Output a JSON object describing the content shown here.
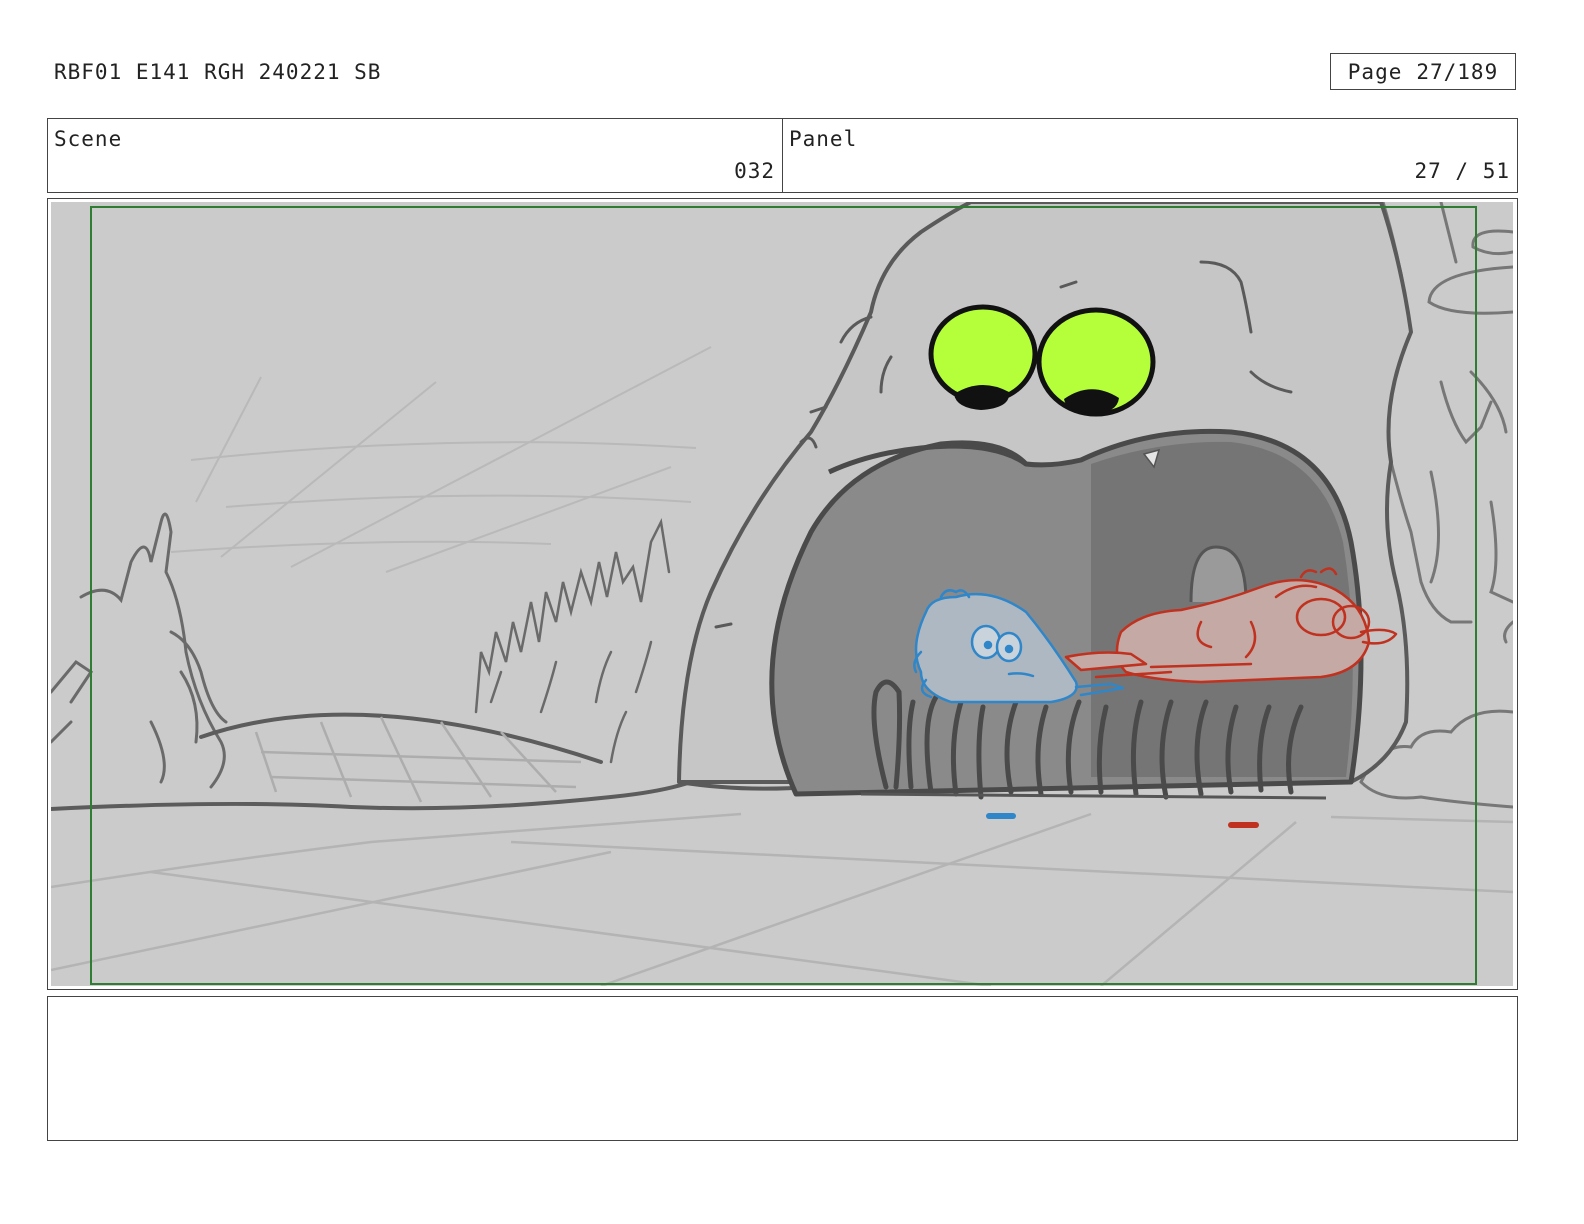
{
  "header": {
    "doc_title": "RBF01 E141 RGH 240221 SB",
    "page_label": "Page",
    "page_value": "27/189"
  },
  "info": {
    "scene_label": "Scene",
    "scene_value": "032",
    "panel_label": "Panel",
    "panel_value": "27 / 51"
  },
  "panel": {
    "safe_area_color": "#2e7d32",
    "eye_color": "#b5ff3a",
    "character_blue_color": "#2f86c8",
    "character_red_color": "#c0311f"
  },
  "notes": {
    "text": ""
  }
}
